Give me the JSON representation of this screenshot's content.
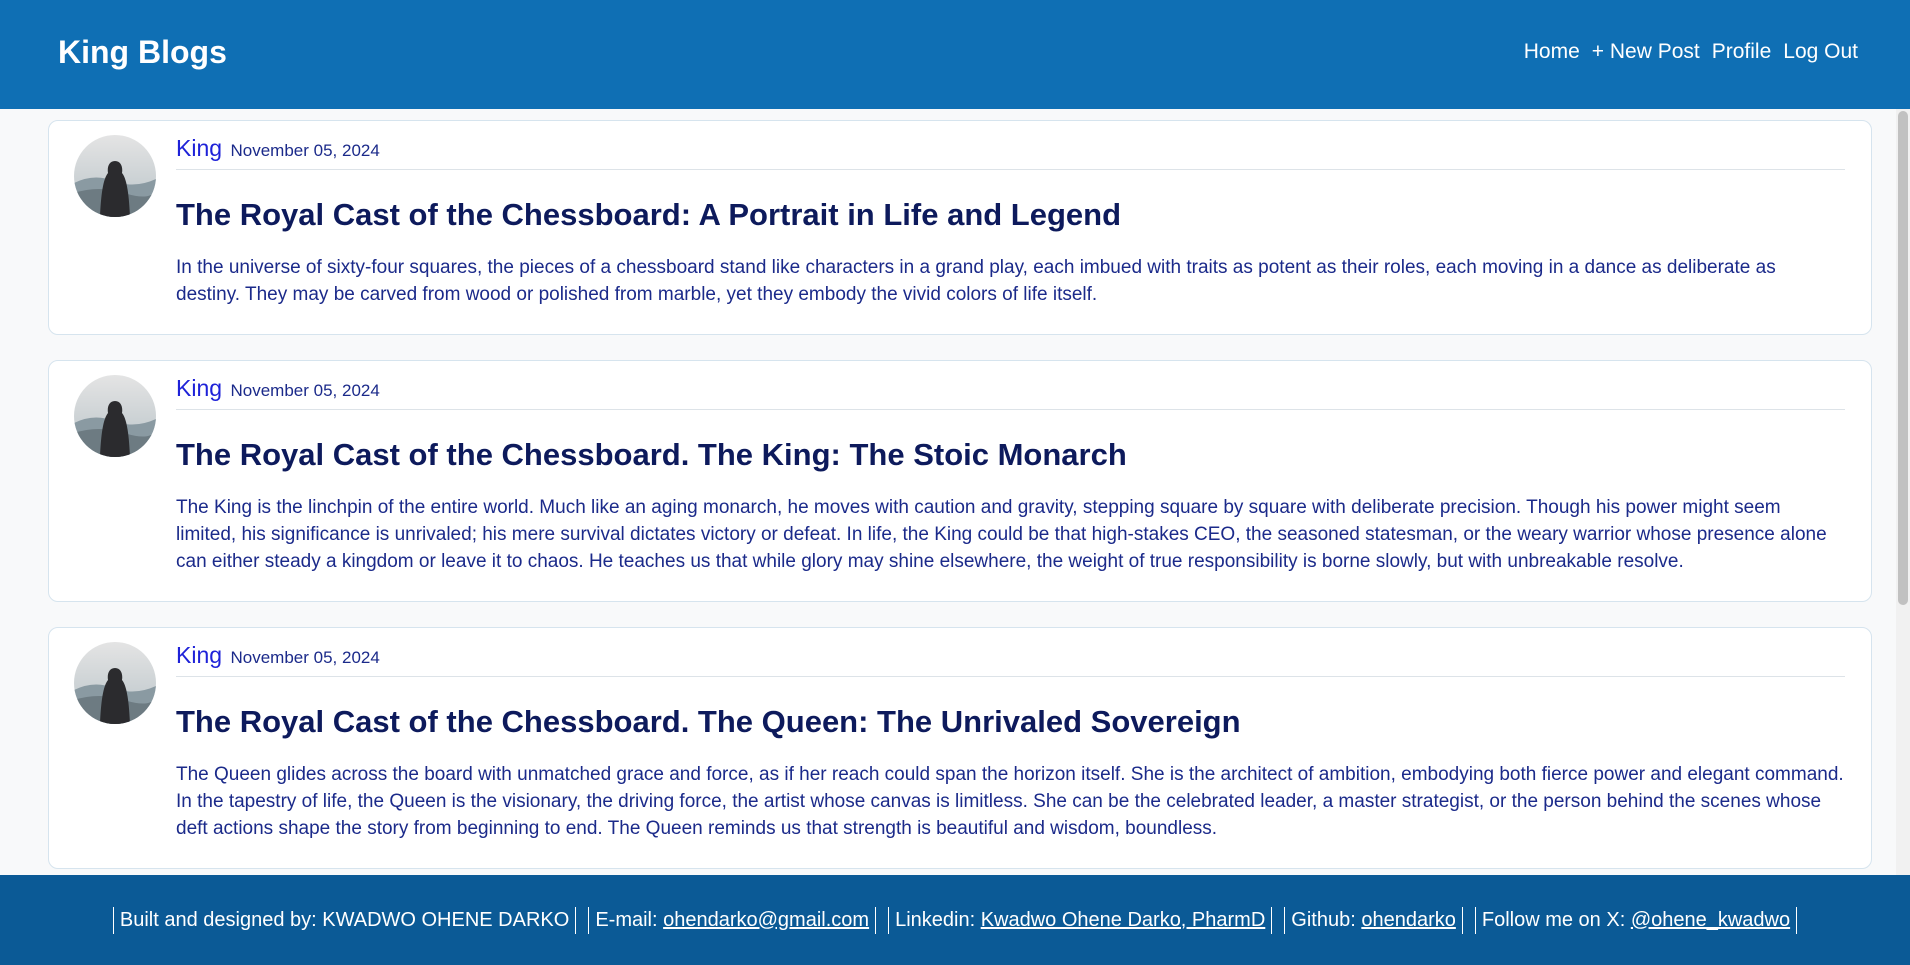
{
  "navbar": {
    "brand": "King Blogs",
    "links": [
      "Home",
      "+ New Post",
      "Profile",
      "Log Out"
    ]
  },
  "posts": [
    {
      "author": "King",
      "date": "November 05, 2024",
      "title": "The Royal Cast of the Chessboard: A Portrait in Life and Legend",
      "body": "In the universe of sixty-four squares, the pieces of a chessboard stand like characters in a grand play, each imbued with traits as potent as their roles, each moving in a dance as deliberate as destiny. They may be carved from wood or polished from marble, yet they embody the vivid colors of life itself."
    },
    {
      "author": "King",
      "date": "November 05, 2024",
      "title": "The Royal Cast of the Chessboard. The King: The Stoic Monarch",
      "body": "The King is the linchpin of the entire world. Much like an aging monarch, he moves with caution and gravity, stepping square by square with deliberate precision. Though his power might seem limited, his significance is unrivaled; his mere survival dictates victory or defeat. In life, the King could be that high-stakes CEO, the seasoned statesman, or the weary warrior whose presence alone can either steady a kingdom or leave it to chaos. He teaches us that while glory may shine elsewhere, the weight of true responsibility is borne slowly, but with unbreakable resolve."
    },
    {
      "author": "King",
      "date": "November 05, 2024",
      "title": "The Royal Cast of the Chessboard. The Queen: The Unrivaled Sovereign",
      "body": "The Queen glides across the board with unmatched grace and force, as if her reach could span the horizon itself. She is the architect of ambition, embodying both fierce power and elegant command. In the tapestry of life, the Queen is the visionary, the driving force, the artist whose canvas is limitless. She can be the celebrated leader, a master strategist, or the person behind the scenes whose deft actions shape the story from beginning to end. The Queen reminds us that strength is beautiful and wisdom, boundless."
    }
  ],
  "footer": {
    "built_label": "Built and designed by: KWADWO OHENE DARKO",
    "email_label": "E-mail: ",
    "email_value": "ohendarko@gmail.com",
    "linkedin_label": "Linkedin: ",
    "linkedin_value": "Kwadwo Ohene Darko, PharmD",
    "github_label": "Github: ",
    "github_value": "ohendarko",
    "x_label": "Follow me on X: ",
    "x_value": "@ohene_kwadwo"
  },
  "colors": {
    "navbar": "#0f6fb4",
    "footer": "#0b5a96",
    "author": "#1e22d8",
    "title": "#0d1a5c",
    "body_text": "#1b2a8a"
  },
  "icons": {
    "avatar": "hooded-figure-avatar"
  }
}
